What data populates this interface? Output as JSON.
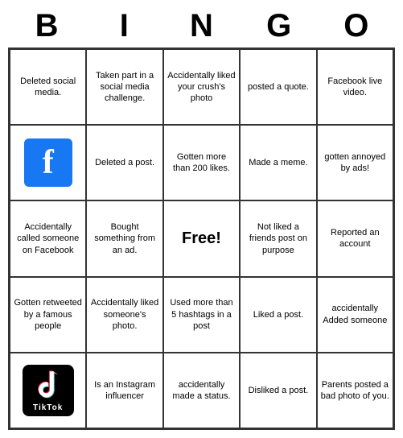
{
  "header": {
    "letters": [
      "B",
      "I",
      "N",
      "G",
      "O"
    ]
  },
  "cells": [
    {
      "id": "r0c0",
      "type": "text",
      "text": "Deleted social media."
    },
    {
      "id": "r0c1",
      "type": "text",
      "text": "Taken part in a social media challenge."
    },
    {
      "id": "r0c2",
      "type": "text",
      "text": "Accidentally liked your crush's photo"
    },
    {
      "id": "r0c3",
      "type": "text",
      "text": "posted a quote."
    },
    {
      "id": "r0c4",
      "type": "text",
      "text": "Facebook live video."
    },
    {
      "id": "r1c0",
      "type": "fb-logo"
    },
    {
      "id": "r1c1",
      "type": "text",
      "text": "Deleted a post."
    },
    {
      "id": "r1c2",
      "type": "text",
      "text": "Gotten more than 200 likes."
    },
    {
      "id": "r1c3",
      "type": "text",
      "text": "Made a meme."
    },
    {
      "id": "r1c4",
      "type": "text",
      "text": "gotten annoyed by ads!"
    },
    {
      "id": "r2c0",
      "type": "text",
      "text": "Accidentally called someone on Facebook"
    },
    {
      "id": "r2c1",
      "type": "text",
      "text": "Bought something from an ad."
    },
    {
      "id": "r2c2",
      "type": "free"
    },
    {
      "id": "r2c3",
      "type": "text",
      "text": "Not liked a friends post on purpose"
    },
    {
      "id": "r2c4",
      "type": "text",
      "text": "Reported an account"
    },
    {
      "id": "r3c0",
      "type": "text",
      "text": "Gotten retweeted by a famous people"
    },
    {
      "id": "r3c1",
      "type": "text",
      "text": "Accidentally liked someone's photo."
    },
    {
      "id": "r3c2",
      "type": "text",
      "text": "Used more than 5 hashtags in a post"
    },
    {
      "id": "r3c3",
      "type": "text",
      "text": "Liked a post."
    },
    {
      "id": "r3c4",
      "type": "text",
      "text": "accidentally Added someone"
    },
    {
      "id": "r4c0",
      "type": "tiktok-logo"
    },
    {
      "id": "r4c1",
      "type": "text",
      "text": "Is an Instagram influencer"
    },
    {
      "id": "r4c2",
      "type": "text",
      "text": "accidentally made a status."
    },
    {
      "id": "r4c3",
      "type": "text",
      "text": "Disliked a post."
    },
    {
      "id": "r4c4",
      "type": "text",
      "text": "Parents posted a bad photo of you."
    }
  ],
  "free_label": "Free!",
  "fb_letter": "f",
  "tiktok_label": "TikTok"
}
